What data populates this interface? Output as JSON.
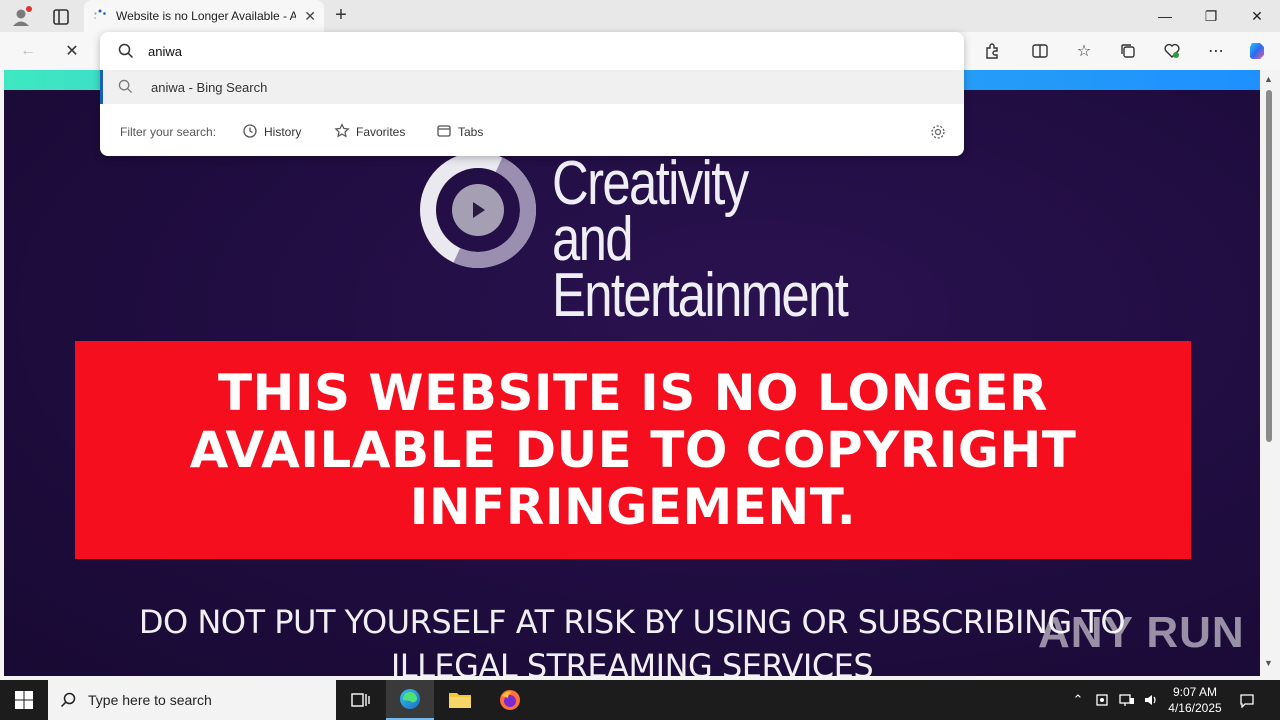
{
  "browser": {
    "tab_title": "Website is no Longer Available - A",
    "omnibox": {
      "input_value": "aniwa",
      "suggestion": "aniwa - Bing Search",
      "filter_label": "Filter your search:",
      "filters": [
        "History",
        "Favorites",
        "Tabs"
      ]
    }
  },
  "page": {
    "logo_line1": "Creativity and",
    "logo_line2": "Entertainment",
    "banner": "THIS WEBSITE IS NO LONGER AVAILABLE DUE TO COPYRIGHT INFRINGEMENT.",
    "warning": "DO NOT PUT YOURSELF AT RISK BY USING OR SUBSCRIBING TO ILLEGAL STREAMING SERVICES",
    "watermark": "ANY RUN"
  },
  "taskbar": {
    "search_placeholder": "Type here to search",
    "time": "9:07 AM",
    "date": "4/16/2025"
  },
  "colors": {
    "banner_red": "#f50f1e",
    "page_bg": "#1f0c3e",
    "accent": "#1a5fb4"
  }
}
